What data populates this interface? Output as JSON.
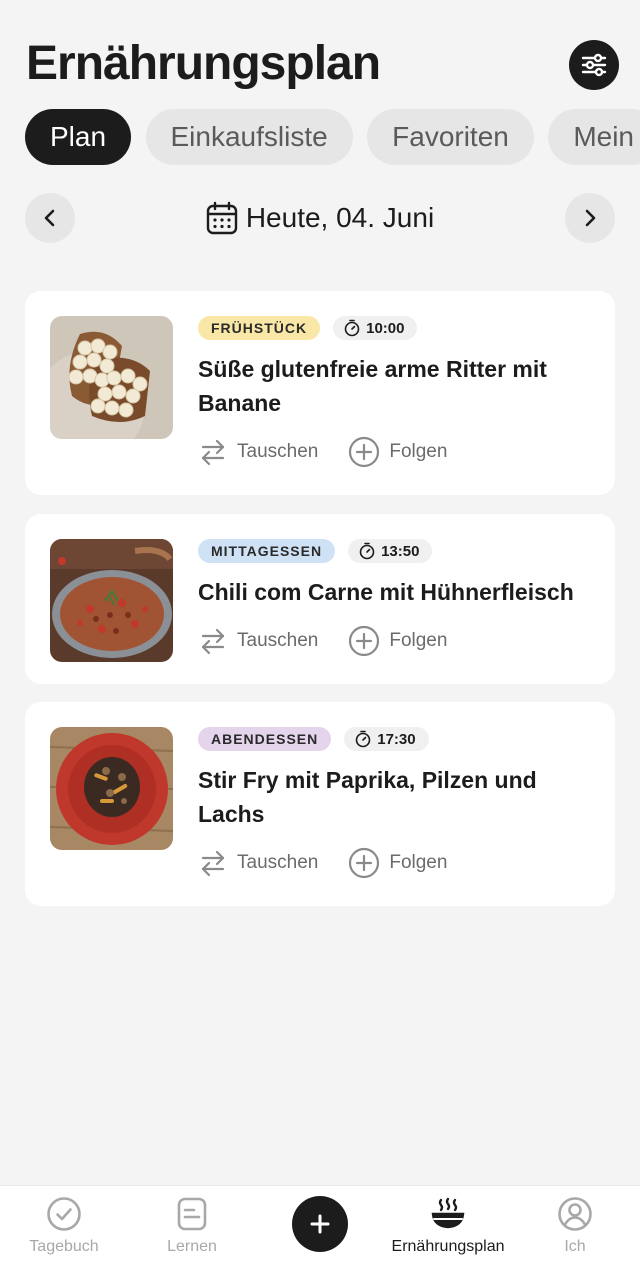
{
  "header": {
    "title": "Ernährungsplan",
    "filter_icon": "sliders-icon"
  },
  "tabs": [
    {
      "label": "Plan",
      "active": true
    },
    {
      "label": "Einkaufsliste",
      "active": false
    },
    {
      "label": "Favoriten",
      "active": false
    },
    {
      "label": "Mein",
      "active": false
    }
  ],
  "date_nav": {
    "label": "Heute, 04. Juni",
    "calendar_icon": "calendar-icon",
    "prev_icon": "chevron-left-icon",
    "next_icon": "chevron-right-icon"
  },
  "meals": [
    {
      "category": "FRÜHSTÜCK",
      "category_color": "#f8e7a6",
      "time": "10:00",
      "title": "Süße glutenfreie arme Ritter mit Banane",
      "swap_label": "Tauschen",
      "follow_label": "Folgen"
    },
    {
      "category": "MITTAGESSEN",
      "category_color": "#cfe2f5",
      "time": "13:50",
      "title": "Chili com Carne mit Hühnerfleisch",
      "swap_label": "Tauschen",
      "follow_label": "Folgen"
    },
    {
      "category": "ABENDESSEN",
      "category_color": "#e4d4ec",
      "time": "17:30",
      "title": "Stir Fry mit Paprika, Pilzen und Lachs",
      "swap_label": "Tauschen",
      "follow_label": "Folgen"
    }
  ],
  "bottom_nav": [
    {
      "label": "Tagebuch",
      "icon": "check-circle-icon",
      "active": false
    },
    {
      "label": "Lernen",
      "icon": "document-icon",
      "active": false
    },
    {
      "label": "",
      "icon": "plus-icon",
      "active": false
    },
    {
      "label": "Ernährungsplan",
      "icon": "bowl-icon",
      "active": true
    },
    {
      "label": "Ich",
      "icon": "user-circle-icon",
      "active": false
    }
  ]
}
